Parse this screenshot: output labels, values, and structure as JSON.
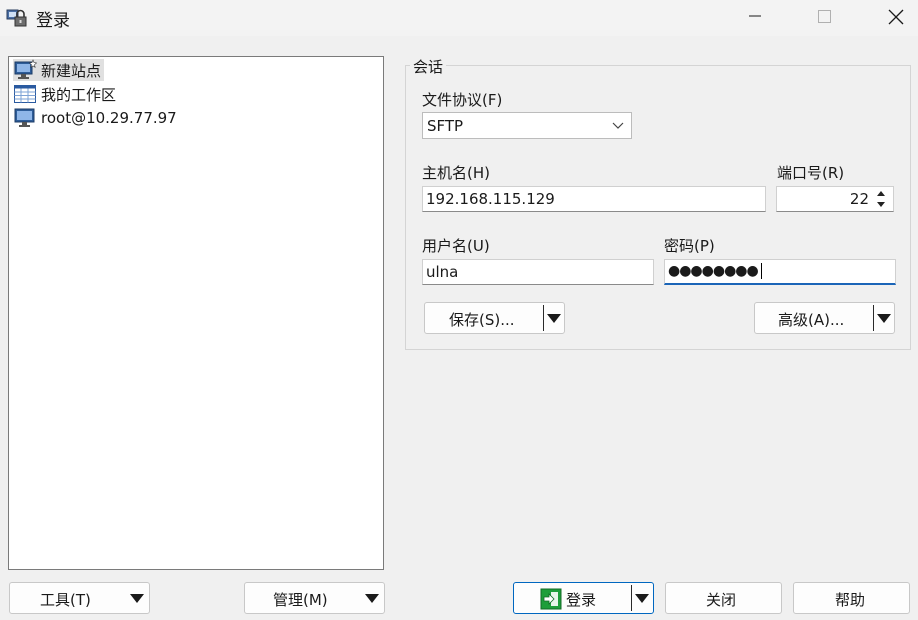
{
  "window": {
    "title": "登录",
    "app_icon": "winscp-lock-icon"
  },
  "tree": {
    "items": [
      {
        "label": "新建站点",
        "icon": "new-site-monitor-icon",
        "selected": true
      },
      {
        "label": "我的工作区",
        "icon": "workspace-grid-icon",
        "selected": false
      },
      {
        "label": "root@10.29.77.97",
        "icon": "monitor-icon",
        "selected": false
      }
    ]
  },
  "session": {
    "legend": "会话",
    "protocol": {
      "label": "文件协议(F)",
      "value": "SFTP"
    },
    "host": {
      "label": "主机名(H)",
      "value": "192.168.115.129"
    },
    "port": {
      "label": "端口号(R)",
      "value": "22"
    },
    "user": {
      "label": "用户名(U)",
      "value": "ulna"
    },
    "password": {
      "label": "密码(P)",
      "masked_value": "●●●●●●●●"
    },
    "save_button": "保存(S)...",
    "advanced_button": "高级(A)..."
  },
  "bottom": {
    "tools_button": "工具(T)",
    "manage_button": "管理(M)",
    "login_button": "登录",
    "close_button": "关闭",
    "help_button": "帮助"
  },
  "colors": {
    "accent": "#0067c0",
    "focus_underline": "#1b65b8",
    "login_icon": "#1e9e3a"
  }
}
